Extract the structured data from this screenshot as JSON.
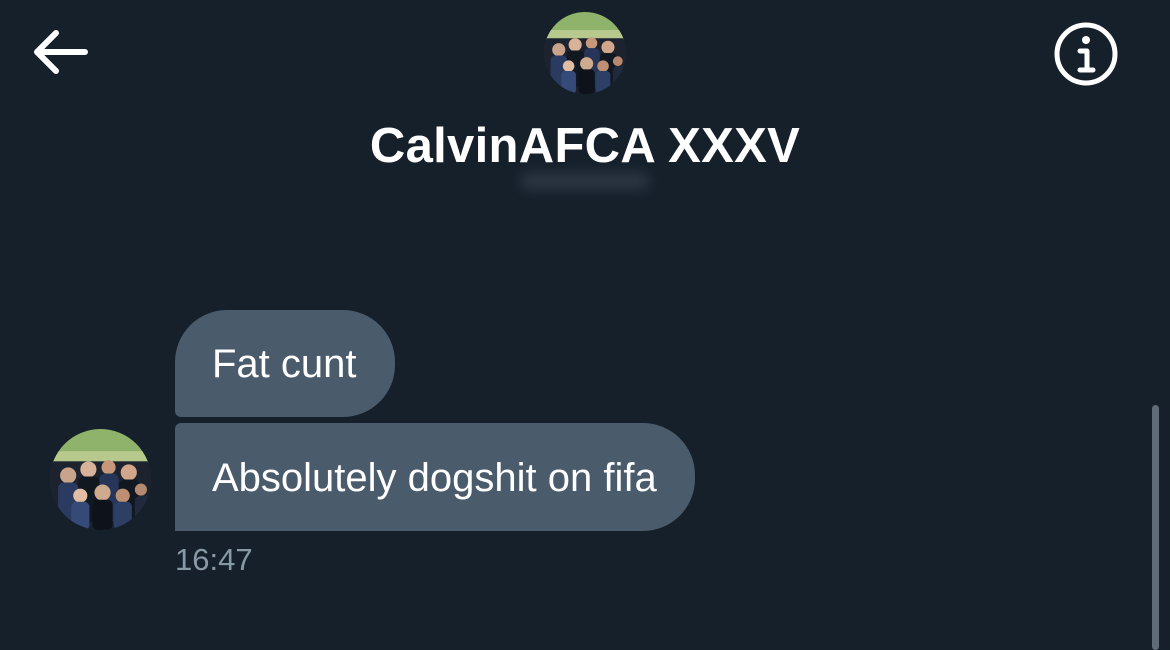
{
  "header": {
    "back_icon": "arrow-left-icon",
    "info_icon": "info-circle-icon",
    "avatar": "group-photo-avatar",
    "name": "CalvinAFCA XXXV"
  },
  "conversation": {
    "messages": [
      {
        "text": "Fat cunt"
      },
      {
        "text": "Absolutely dogshit on fifa"
      }
    ],
    "sender_avatar": "group-photo-avatar",
    "timestamp": "16:47"
  },
  "colors": {
    "background": "#15202b",
    "bubble": "#4a5b6b",
    "text": "#ffffff",
    "muted_text": "#8899a6"
  }
}
